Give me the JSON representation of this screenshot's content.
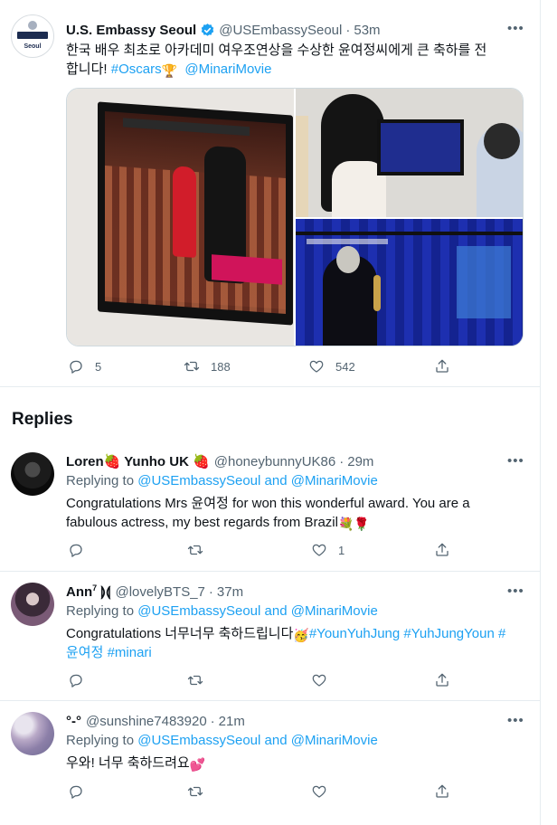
{
  "main_tweet": {
    "name": "U.S. Embassy Seoul",
    "handle": "@USEmbassySeoul",
    "time": "53m",
    "avatar_text": "Seoul",
    "avatar_band": "U.S. EMBASSY",
    "text_line1": "한국 배우 최초로 아카데미 여우조연상을 수상한 윤여정씨에게 큰 축하를 전",
    "text_line2_prefix": "합니다! ",
    "hashtag_oscars": "#Oscars",
    "trophy_emoji": "🏆",
    "mention_minari": "@MinariMovie",
    "counts": {
      "replies": "5",
      "retweets": "188",
      "likes": "542"
    }
  },
  "replies_title": "Replies",
  "replies": [
    {
      "name": "Loren🍓 Yunho UK 🍓",
      "handle": "@honeybunnyUK86",
      "time": "29m",
      "replying_prefix": "Replying to ",
      "replying_to_1": "@USEmbassySeoul",
      "replying_and": " and ",
      "replying_to_2": "@MinariMovie",
      "text_line1": "Congratulations Mrs 윤여정 for won this wonderful award. You are a",
      "text_line2": "fabulous actress, my best regards from Brazil",
      "text_emojis": "💐🌹",
      "like_count": "1"
    },
    {
      "name": "Ann",
      "name_sup": "7",
      "name_suffix": " ⟭⟬",
      "handle": "@lovelyBTS_7",
      "time": "37m",
      "replying_prefix": "Replying to ",
      "replying_to_1": "@USEmbassySeoul",
      "replying_and": " and ",
      "replying_to_2": "@MinariMovie",
      "text_prefix": "Congratulations 너무너무 축하드립니다",
      "text_emoji": "🥳",
      "tag1": "#YounYuhJung",
      "tag2": "#YuhJungYoun",
      "tag3_part1": "#",
      "tag3_part2": "윤여정",
      "tag4": "#minari",
      "like_count": ""
    },
    {
      "name": "°-°",
      "handle": "@sunshine7483920",
      "time": "21m",
      "replying_prefix": "Replying to ",
      "replying_to_1": "@USEmbassySeoul",
      "replying_and": " and ",
      "replying_to_2": "@MinariMovie",
      "text": "우와! 너무 축하드려요",
      "text_emoji": "💕",
      "like_count": ""
    }
  ],
  "colors": {
    "link": "#1da1f2",
    "muted": "#536471",
    "text": "#0f1419",
    "verified": "#1da1f2"
  },
  "icons": [
    "more-icon",
    "verified-badge-icon",
    "reply-icon",
    "retweet-icon",
    "like-icon",
    "share-icon"
  ]
}
